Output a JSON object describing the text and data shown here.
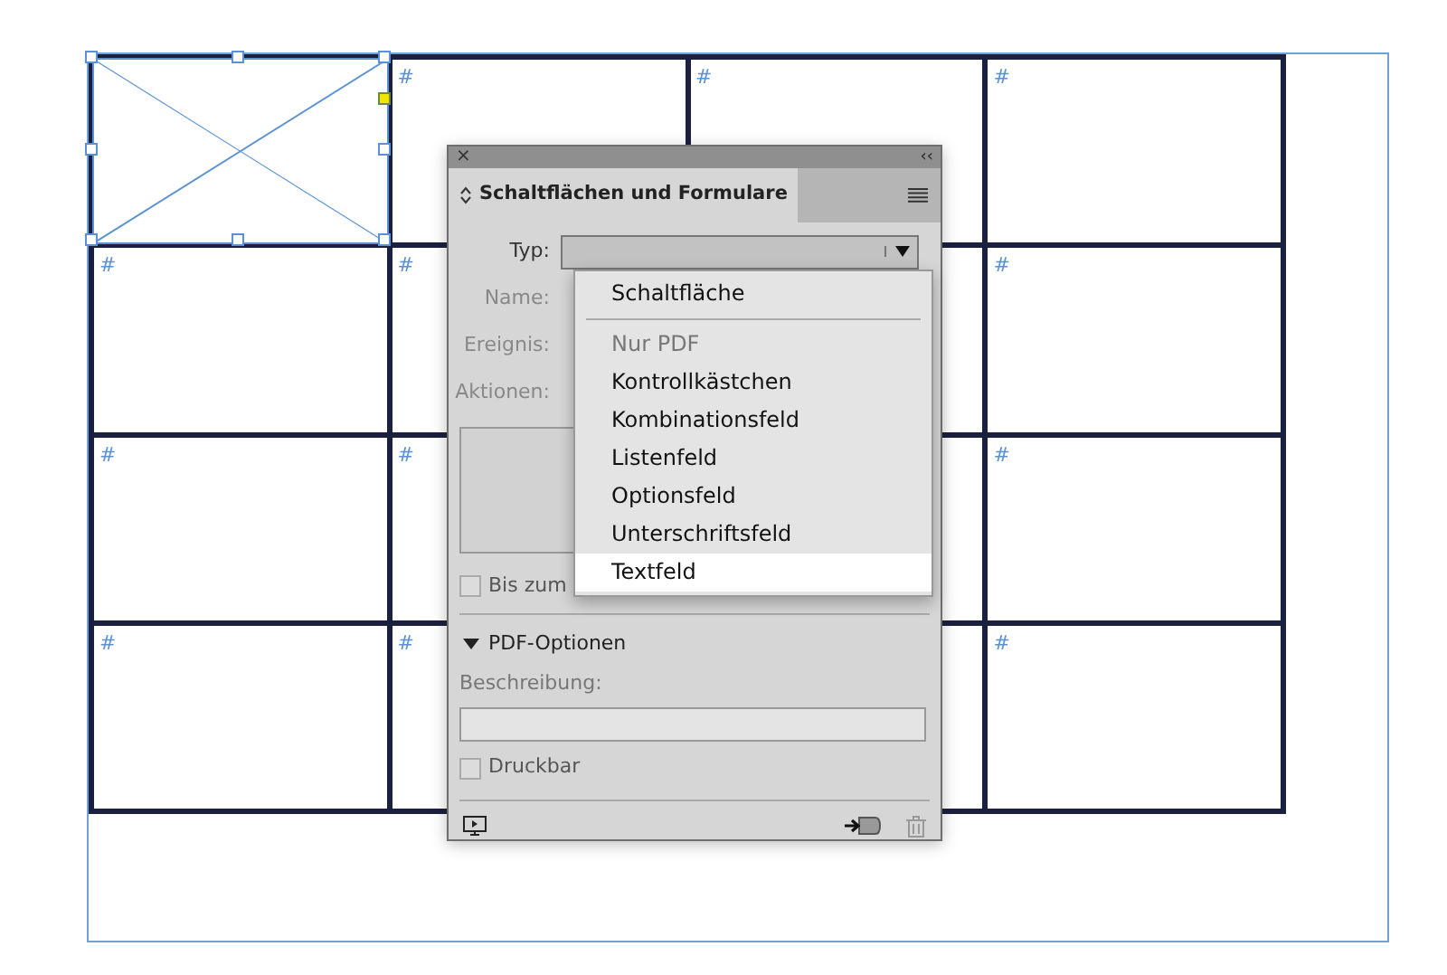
{
  "canvas": {
    "cells": [
      {
        "kind": "image-frame",
        "selected": true
      },
      {
        "kind": "text-frame",
        "marker": "#"
      },
      {
        "kind": "text-frame",
        "marker": "#"
      },
      {
        "kind": "text-frame",
        "marker": "#"
      },
      {
        "kind": "text-frame",
        "marker": "#"
      },
      {
        "kind": "text-frame",
        "marker": "#"
      },
      {
        "kind": "text-frame"
      },
      {
        "kind": "text-frame",
        "marker": "#"
      },
      {
        "kind": "text-frame",
        "marker": "#"
      },
      {
        "kind": "text-frame",
        "marker": "#"
      },
      {
        "kind": "text-frame"
      },
      {
        "kind": "text-frame",
        "marker": "#"
      },
      {
        "kind": "text-frame",
        "marker": "#"
      },
      {
        "kind": "text-frame",
        "marker": "#"
      },
      {
        "kind": "text-frame"
      },
      {
        "kind": "text-frame",
        "marker": "#"
      }
    ]
  },
  "panel": {
    "close": "×",
    "collapse": "‹‹",
    "title": "Schaltflächen und Formulare",
    "fields": [
      {
        "label": "Typ:",
        "disabled": false
      },
      {
        "label": "Name:",
        "disabled": true
      },
      {
        "label": "Ereignis:",
        "disabled": true
      },
      {
        "label": "Aktionen:",
        "disabled": true
      }
    ],
    "hidden_checkbox": {
      "label": "Bis zum",
      "checked": false
    },
    "pdf_section": {
      "title": "PDF-Optionen",
      "expanded": true,
      "description_label": "Beschreibung:",
      "printable": {
        "label": "Druckbar",
        "checked": false
      }
    },
    "dropdown": {
      "items": [
        {
          "kind": "item",
          "label": "Schaltfläche",
          "disabled": false,
          "selected": false
        },
        {
          "kind": "separator"
        },
        {
          "kind": "item",
          "label": "Nur PDF",
          "disabled": true,
          "selected": false
        },
        {
          "kind": "item",
          "label": "Kontrollkästchen",
          "disabled": false,
          "selected": false
        },
        {
          "kind": "item",
          "label": "Kombinationsfeld",
          "disabled": false,
          "selected": false
        },
        {
          "kind": "item",
          "label": "Listenfeld",
          "disabled": false,
          "selected": false
        },
        {
          "kind": "item",
          "label": "Optionsfeld",
          "disabled": false,
          "selected": false
        },
        {
          "kind": "item",
          "label": "Unterschriftsfeld",
          "disabled": false,
          "selected": false
        },
        {
          "kind": "item",
          "label": "Textfeld",
          "disabled": false,
          "selected": true
        }
      ]
    }
  }
}
